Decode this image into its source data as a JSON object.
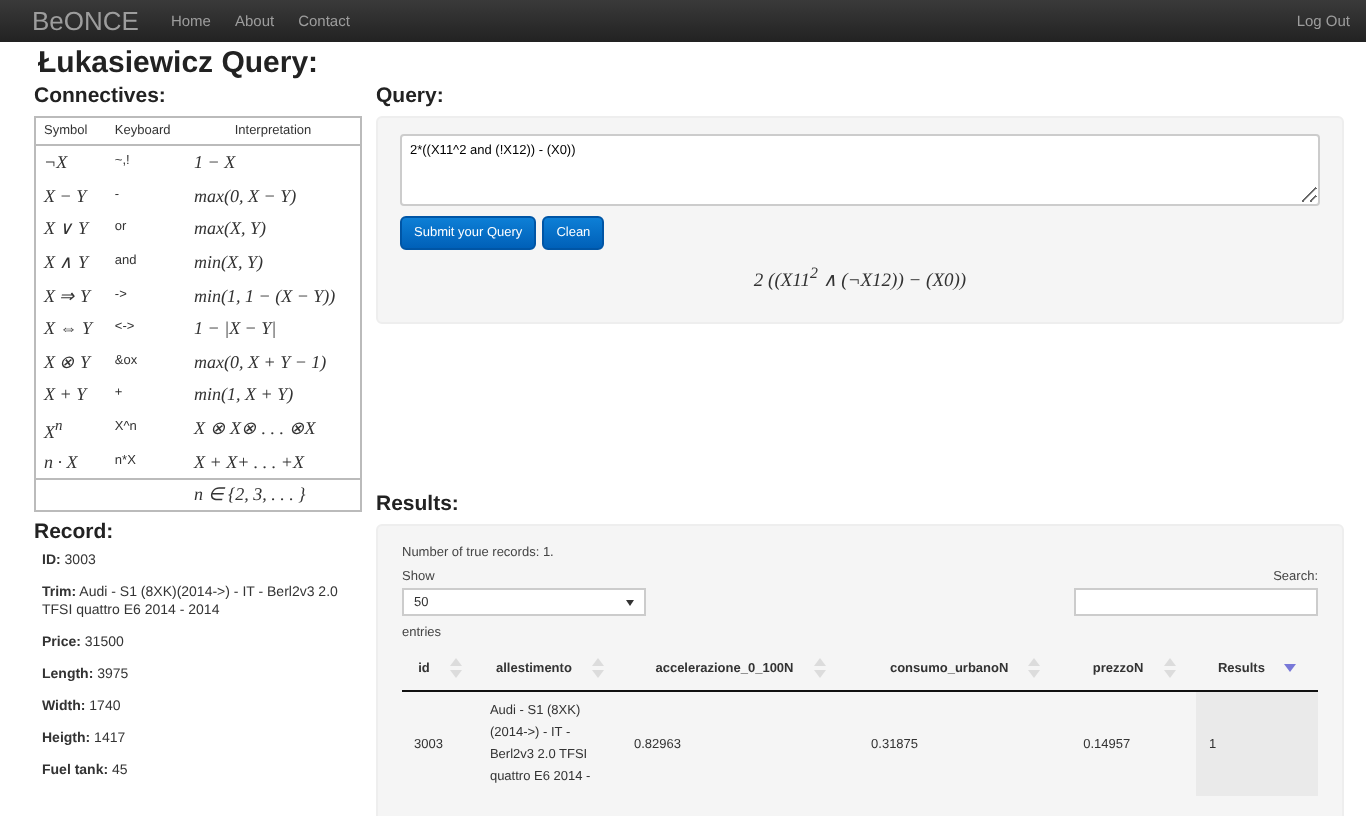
{
  "navbar": {
    "brand": "BeONCE",
    "links": [
      {
        "label": "Home"
      },
      {
        "label": "About"
      },
      {
        "label": "Contact"
      }
    ],
    "logout": "Log Out"
  },
  "title": "Łukasiewicz Query:",
  "connectives": {
    "heading": "Connectives:",
    "columns": [
      "Symbol",
      "Keyboard",
      "Interpretation"
    ],
    "rows": [
      {
        "symbol": "¬X",
        "keyboard": "~,!",
        "interpretation": "1 − X"
      },
      {
        "symbol": "X − Y",
        "keyboard": "-",
        "interpretation": "max(0, X − Y)"
      },
      {
        "symbol": "X ∨ Y",
        "keyboard": "or",
        "interpretation": "max(X, Y)"
      },
      {
        "symbol": "X ∧ Y",
        "keyboard": "and",
        "interpretation": "min(X, Y)"
      },
      {
        "symbol": "X ⇒ Y",
        "keyboard": "->",
        "interpretation": "min(1, 1 − (X − Y))"
      },
      {
        "symbol": "X ⇔ Y",
        "keyboard": "<->",
        "interpretation": "1 − |X − Y|"
      },
      {
        "symbol": "X ⊗ Y",
        "keyboard": "&ox",
        "interpretation": "max(0, X + Y − 1)"
      },
      {
        "symbol": "X + Y",
        "keyboard": "+",
        "interpretation": "min(1, X + Y)"
      },
      {
        "symbol": "X$^{n}$",
        "keyboard": "X^n",
        "interpretation": "X ⊗ X⊗ . . . ⊗X"
      },
      {
        "symbol": "n · X",
        "keyboard": "n*X",
        "interpretation": "X + X+ . . . +X"
      }
    ],
    "footnote": "n ∈ {2, 3, . . . }"
  },
  "record": {
    "heading": "Record:",
    "fields": [
      "**ID:** 3003",
      "**Trim:** Audi - S1 (8XK)(2014->) - IT - Berl2v3 2.0 TFSI quattro E6 2014 - 2014",
      "**Price:** 31500",
      "**Length:** 3975",
      "**Width:** 1740",
      "**Heigth:** 1417",
      "**Fuel tank:** 45"
    ]
  },
  "query": {
    "heading": "Query:",
    "value": "2*((X11^2 and (!X12)) - (X0))",
    "buttons": [
      "Submit your Query",
      "Clean"
    ],
    "formula": "2 ((X11$^{2}$ ∧ (¬X12)) − (X0))"
  },
  "results": {
    "heading": "Results:",
    "summary": "Number of true records: 1.",
    "show_label": "Show",
    "page_size": "50",
    "entries_label": "entries",
    "search_label": "Search:",
    "columns": [
      {
        "label": "id",
        "sorted": false
      },
      {
        "label": "allestimento",
        "sorted": false
      },
      {
        "label": "accelerazione_0_100N",
        "sorted": false
      },
      {
        "label": "consumo_urbanoN",
        "sorted": false
      },
      {
        "label": "prezzoN",
        "sorted": false
      },
      {
        "label": "Results",
        "sorted": true
      }
    ],
    "rows": [
      [
        "3003",
        "Audi - S1 (8XK) (2014->) - IT - Berl2v3 2.0 TFSI quattro E6 2014 -",
        "0.82963",
        "0.31875",
        "0.14957",
        "1"
      ]
    ]
  }
}
